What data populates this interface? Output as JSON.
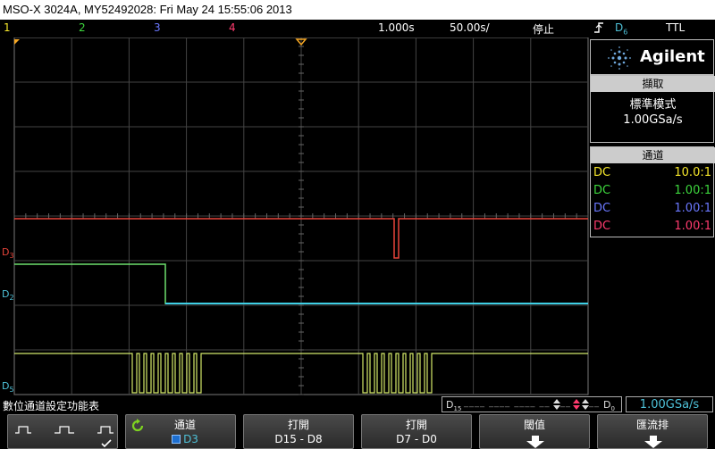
{
  "window": {
    "title": "MSO-X 3024A, MY52492028: Fri May 24 15:55:06 2013"
  },
  "status_bar": {
    "channels": [
      {
        "label": "1",
        "color": "#f5e62b"
      },
      {
        "label": "2",
        "color": "#3dd63d"
      },
      {
        "label": "3",
        "color": "#6b78ff"
      },
      {
        "label": "4",
        "color": "#ff3b6e"
      }
    ],
    "timebase": "1.000s",
    "position": "50.00s/",
    "run_state": "停止",
    "trigger_source": "D",
    "trigger_source_sub": "6",
    "trigger_level": "TTL"
  },
  "waveform_labels": {
    "d3": {
      "main": "D",
      "sub": "3"
    },
    "d2": {
      "main": "D",
      "sub": "2"
    },
    "d5": {
      "main": "D",
      "sub": "5"
    }
  },
  "side_panel": {
    "brand": "Agilent",
    "acquire_header": "擷取",
    "acquire_mode": "標準模式",
    "sample_rate": "1.00GSa/s",
    "channel_header": "通道",
    "channels": [
      {
        "coupling": "DC",
        "probe": "10.0:1",
        "color": "#f5e62b"
      },
      {
        "coupling": "DC",
        "probe": "1.00:1",
        "color": "#3dd63d"
      },
      {
        "coupling": "DC",
        "probe": "1.00:1",
        "color": "#6b78ff"
      },
      {
        "coupling": "DC",
        "probe": "1.00:1",
        "color": "#ff3b6e"
      }
    ]
  },
  "bottom_info": {
    "menu_title": "數位通道設定功能表",
    "range_left": "D",
    "range_left_sub": "15",
    "range_right": "D",
    "range_right_sub": "0",
    "sample_rate": "1.00GSa/s"
  },
  "softkeys": {
    "channel_label": "通道",
    "channel_value": "D3",
    "open_label_1": "打開",
    "open_value_1": "D15 - D8",
    "open_label_2": "打開",
    "open_value_2": "D7 - D0",
    "threshold_label": "閾值",
    "bus_label": "匯流排"
  }
}
